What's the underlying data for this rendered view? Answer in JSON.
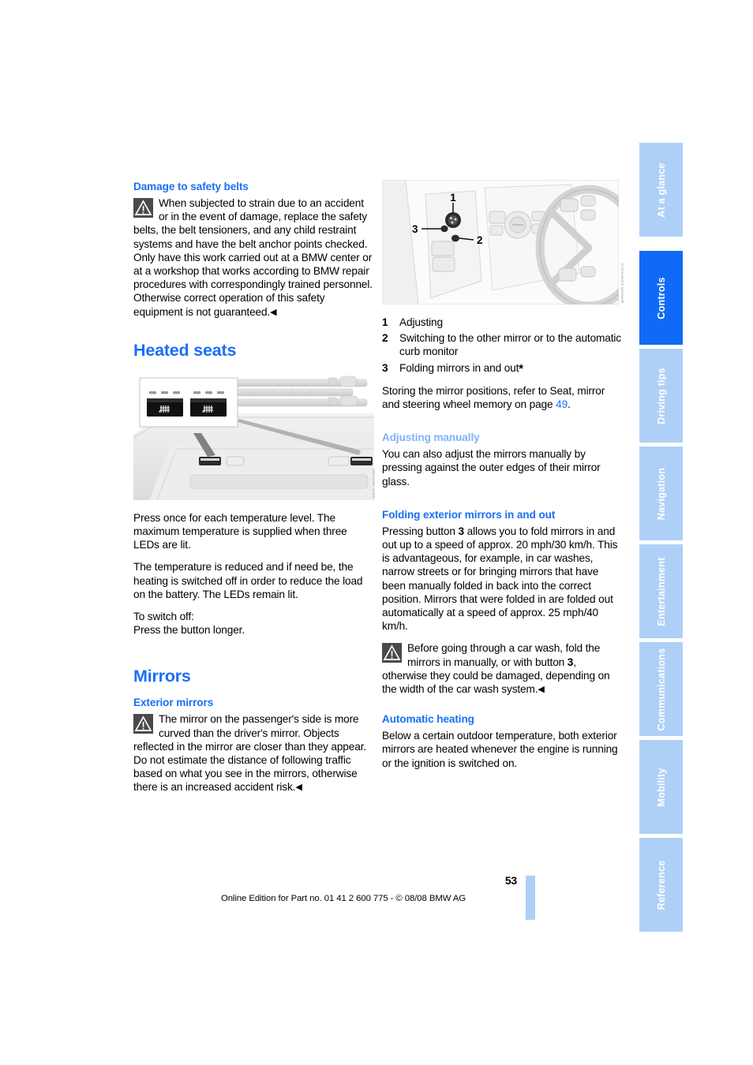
{
  "page_number": "53",
  "imprint": "Online Edition for Part no. 01 41 2 600 775 - © 08/08 BMW AG",
  "colors": {
    "heading_blue": "#1a6ff5",
    "pale_blue": "#7eb3f7",
    "tab_inactive": "#aed0f7",
    "tab_active": "#0f6bf5"
  },
  "tabs": [
    {
      "label": "At a glance",
      "active": false
    },
    {
      "label": "Controls",
      "active": true
    },
    {
      "label": "Driving tips",
      "active": false
    },
    {
      "label": "Navigation",
      "active": false
    },
    {
      "label": "Entertainment",
      "active": false
    },
    {
      "label": "Communications",
      "active": false
    },
    {
      "label": "Mobility",
      "active": false
    },
    {
      "label": "Reference",
      "active": false
    }
  ],
  "left_column": {
    "damage_heading": "Damage to safety belts",
    "damage_warning": "When subjected to strain due to an accident or in the event of damage, replace the safety belts, the belt tensioners, and any child restraint systems and have the belt anchor points checked. Only have this work carried out at a BMW center or at a workshop that works according to BMW repair procedures with correspondingly trained personnel. Otherwise correct operation of this safety equipment is not guaranteed.",
    "heated_seats_heading": "Heated seats",
    "heated_seats_figure": {
      "credit": "SEAT HEATING",
      "alt": "Center console with two heated seat buttons, each with three LED indicators above"
    },
    "p1": "Press once for each temperature level. The maximum temperature is supplied when three LEDs are lit.",
    "p2": "The temperature is reduced and if need be, the heating is switched off in order to reduce the load on the battery. The LEDs remain lit.",
    "p3_line1": "To switch off:",
    "p3_line2": "Press the button longer.",
    "mirrors_heading": "Mirrors",
    "exterior_mirrors_heading": "Exterior mirrors",
    "exterior_warning": "The mirror on the passenger's side is more curved than the driver's mirror. Objects reflected in the mirror are closer than they appear. Do not estimate the distance of following traffic based on what you see in the mirrors, otherwise there is an increased accident risk."
  },
  "right_column": {
    "mirror_figure": {
      "credit": "MIRROR CONTROLS",
      "alt": "Driver's door panel with mirror adjustment controls and steering wheel",
      "callouts": [
        "1",
        "2",
        "3"
      ]
    },
    "legend": [
      {
        "num": "1",
        "text": "Adjusting"
      },
      {
        "num": "2",
        "text": "Switching to the other mirror or to the automatic curb monitor"
      },
      {
        "num": "3",
        "text": "Folding mirrors in and out",
        "asterisk": "*"
      }
    ],
    "storing_text_before": "Storing the mirror positions, refer to Seat, mirror and steering wheel memory on page ",
    "storing_page_ref": "49",
    "storing_text_after": ".",
    "adjusting_manually_heading": "Adjusting manually",
    "adjusting_manually_body": "You can also adjust the mirrors manually by pressing against the outer edges of their mirror glass.",
    "folding_heading": "Folding exterior mirrors in and out",
    "folding_p_a": "Pressing button ",
    "folding_p_bold": "3",
    "folding_p_b": " allows you to fold mirrors in and out up to a speed of approx. 20 mph/30 km/h. This is advantageous, for example, in car washes, narrow streets or for bringing mirrors that have been manually folded in back into the correct position. Mirrors that were folded in are folded out automatically at a speed of approx. 25 mph/40 km/h.",
    "carwash_warning_a": "Before going through a car wash, fold the mirrors in manually, or with button ",
    "carwash_warning_bold": "3",
    "carwash_warning_b": ", otherwise they could be damaged, depending on the width of the car wash system.",
    "auto_heating_heading": "Automatic heating",
    "auto_heating_body": "Below a certain outdoor temperature, both exterior mirrors are heated whenever the engine is running or the ignition is switched on."
  }
}
